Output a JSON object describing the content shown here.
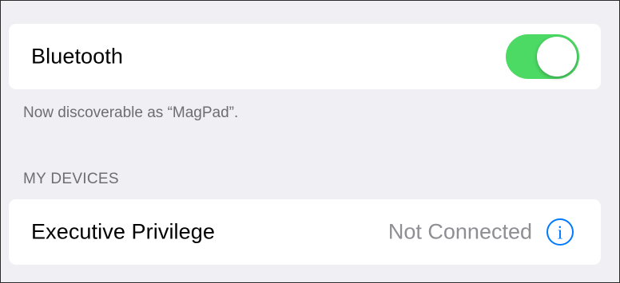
{
  "bluetooth": {
    "label": "Bluetooth",
    "enabled": true,
    "toggle_color": "#4cd964",
    "discoverable_text": "Now discoverable as “MagPad”."
  },
  "my_devices": {
    "header": "MY DEVICES",
    "devices": [
      {
        "name": "Executive Privilege",
        "status": "Not Connected",
        "icon": "info-icon",
        "icon_color": "#007aff"
      }
    ]
  },
  "colors": {
    "background": "#efeff4",
    "secondary_text": "#6d6d72",
    "status_text": "#8e8e93"
  }
}
